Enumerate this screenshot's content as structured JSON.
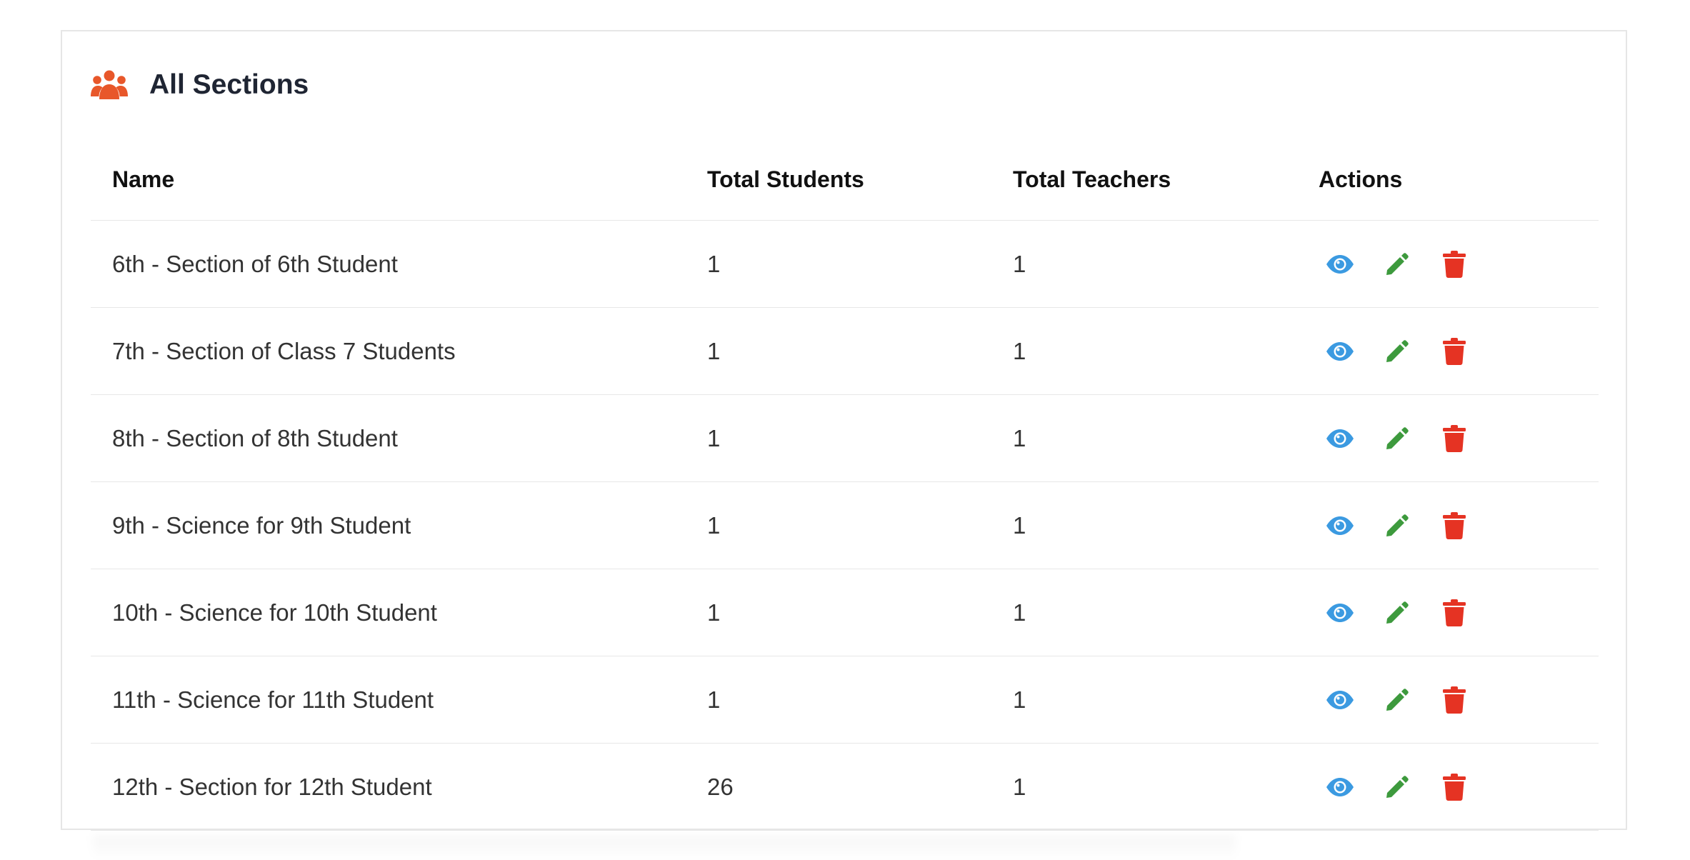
{
  "header": {
    "title": "All Sections",
    "icon": "users-group-icon",
    "icon_color": "#e8572a"
  },
  "table": {
    "columns": [
      "Name",
      "Total Students",
      "Total Teachers",
      "Actions"
    ],
    "rows": [
      {
        "name": "6th - Section of 6th Student",
        "students": "1",
        "teachers": "1"
      },
      {
        "name": "7th - Section of Class 7 Students",
        "students": "1",
        "teachers": "1"
      },
      {
        "name": "8th - Section of 8th Student",
        "students": "1",
        "teachers": "1"
      },
      {
        "name": "9th - Science for 9th Student",
        "students": "1",
        "teachers": "1"
      },
      {
        "name": "10th - Science for 10th Student",
        "students": "1",
        "teachers": "1"
      },
      {
        "name": "11th - Science for 11th Student",
        "students": "1",
        "teachers": "1"
      },
      {
        "name": "12th - Section for 12th Student",
        "students": "26",
        "teachers": "1"
      }
    ],
    "actions": [
      {
        "name": "view",
        "icon": "eye-icon",
        "color": "#3b9ae1"
      },
      {
        "name": "edit",
        "icon": "pencil-icon",
        "color": "#3d9a3d"
      },
      {
        "name": "delete",
        "icon": "trash-icon",
        "color": "#e53323"
      }
    ]
  }
}
